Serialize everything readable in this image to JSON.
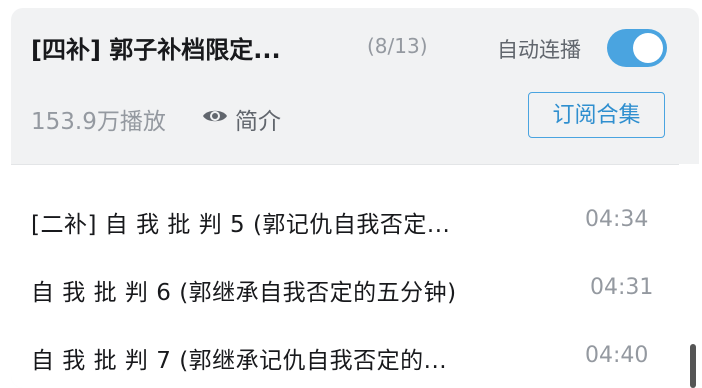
{
  "header": {
    "title": "[四补] 郭子补档限定...",
    "progress": "(8/13)",
    "autoplay_label": "自动连播",
    "autoplay_on": true
  },
  "stats": {
    "plays": "153.9万播放",
    "intro_label": "简介",
    "subscribe_label": "订阅合集"
  },
  "episodes": [
    {
      "title": "[二补] 自 我 批 判 5 (郭记仇自我否定...",
      "duration": "04:34"
    },
    {
      "title": "自 我 批 判 6 (郭继承自我否定的五分钟)",
      "duration": "04:31"
    },
    {
      "title": "自 我 批 判 7 (郭继承记仇自我否定的...",
      "duration": "04:40"
    }
  ],
  "colors": {
    "accent": "#4aa4e0",
    "panel_bg": "#f1f2f3",
    "muted_text": "#9499a0"
  }
}
